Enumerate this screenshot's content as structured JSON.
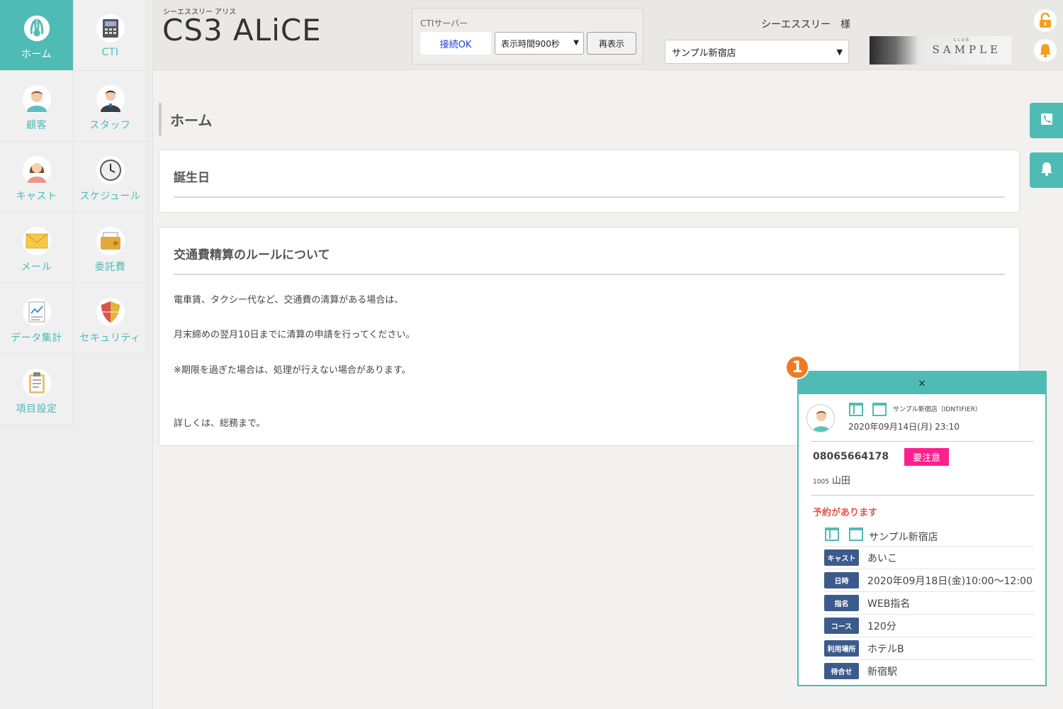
{
  "header": {
    "brand_sub": "シーエススリー アリス",
    "brand": "CS3 ALiCE",
    "cti_title": "CTIサーバー",
    "cti_status": "接続OK",
    "cti_display_select": "表示時間900秒",
    "cti_refresh": "再表示",
    "user_name": "シーエススリー　様",
    "store_select": "サンプル新宿店",
    "logo_small": "CLUB",
    "logo_text": "SAMPLE"
  },
  "sidebar": {
    "items": [
      {
        "label": "ホーム",
        "icon": "rabbit-icon"
      },
      {
        "label": "CTI",
        "icon": "phone-icon"
      },
      {
        "label": "顧客",
        "icon": "customer-icon"
      },
      {
        "label": "スタッフ",
        "icon": "staff-icon"
      },
      {
        "label": "キャスト",
        "icon": "cast-icon"
      },
      {
        "label": "スケジュール",
        "icon": "clock-icon"
      },
      {
        "label": "メール",
        "icon": "mail-icon"
      },
      {
        "label": "委託費",
        "icon": "wallet-icon"
      },
      {
        "label": "データ集計",
        "icon": "report-icon"
      },
      {
        "label": "セキュリティ",
        "icon": "shield-icon"
      },
      {
        "label": "項目設定",
        "icon": "clipboard-icon"
      }
    ]
  },
  "main": {
    "page_title": "ホーム",
    "birthday_title": "誕生日",
    "notice_title": "交通費精算のルールについて",
    "notice_lines": [
      "電車賃、タクシー代など、交通費の清算がある場合は、",
      "月末締めの翌月10日までに清算の申請を行ってください。",
      "※期限を過ぎた場合は、処理が行えない場合があります。",
      "詳しくは、総務まで。"
    ]
  },
  "popup": {
    "badge": "1",
    "close": "×",
    "store_identifier": "サンプル新宿店（IDNTIFIER）",
    "datetime": "2020年09月14日(月) 23:10",
    "phone": "08065664178",
    "warning": "要注意",
    "customer_id": "1005",
    "customer_name": "山田",
    "reservation_notice": "予約があります",
    "reservation_store": "サンプル新宿店",
    "rows": [
      {
        "tag": "キャスト",
        "value": "あいこ"
      },
      {
        "tag": "日時",
        "value": "2020年09月18日(金)10:00〜12:00"
      },
      {
        "tag": "指名",
        "value": "WEB指名"
      },
      {
        "tag": "コース",
        "value": "120分"
      },
      {
        "tag": "利用場所",
        "value": "ホテルB"
      },
      {
        "tag": "待合せ",
        "value": "新宿駅"
      }
    ]
  },
  "colors": {
    "accent": "#4fbbb5",
    "warning": "#ff1f8e",
    "tag": "#3b5b8c",
    "reservation": "#e5534b",
    "badge": "#f07a22"
  }
}
